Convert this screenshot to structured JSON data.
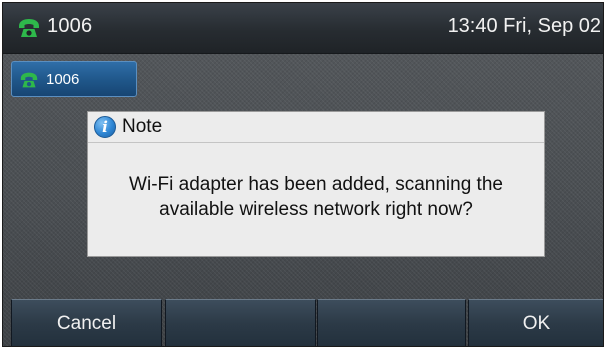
{
  "status_bar": {
    "account": "1006",
    "datetime": "13:40 Fri, Sep 02",
    "icon": "phone-icon",
    "icon_color": "#2eb84b"
  },
  "line_key": {
    "label": "1006",
    "icon": "phone-icon"
  },
  "dialog": {
    "icon": "info-icon",
    "icon_glyph": "i",
    "title": "Note",
    "message_line1": "Wi-Fi adapter has been added, scanning the",
    "message_line2": "available wireless network right now?"
  },
  "softkeys": {
    "key1": "Cancel",
    "key2": "",
    "key3": "",
    "key4": "OK"
  }
}
